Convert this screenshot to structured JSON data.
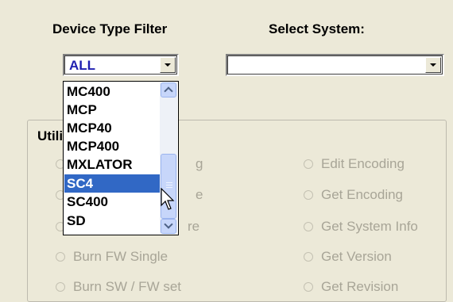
{
  "device_filter": {
    "label": "Device Type Filter",
    "selected_value": "ALL",
    "list_items": [
      "MC400",
      "MCP",
      "MCP40",
      "MCP400",
      "MXLATOR",
      "SC4",
      "SC400",
      "SD"
    ],
    "highlighted_item": "SC4"
  },
  "system_select": {
    "label": "Select System:",
    "value": ""
  },
  "utilities": {
    "title": "Utili",
    "left_options": [
      {
        "label": "Burn FW Single",
        "state": "disabled"
      }
    ],
    "left_options_hidden_partial": [
      "g",
      "e",
      "re"
    ],
    "left_bottom_partial": "Burn SW / FW set",
    "right_options": [
      {
        "label": "Edit Encoding",
        "state": "disabled"
      },
      {
        "label": "Get Encoding",
        "state": "disabled"
      },
      {
        "label": "Get System Info",
        "state": "disabled"
      },
      {
        "label": "Get Version",
        "state": "disabled"
      }
    ],
    "right_bottom_partial": "Get Revision"
  },
  "colors": {
    "window_bg": "#ece9d8",
    "selection": "#3168c5",
    "disabled_text": "#a8a597",
    "combo_text": "#1f1fb0"
  }
}
